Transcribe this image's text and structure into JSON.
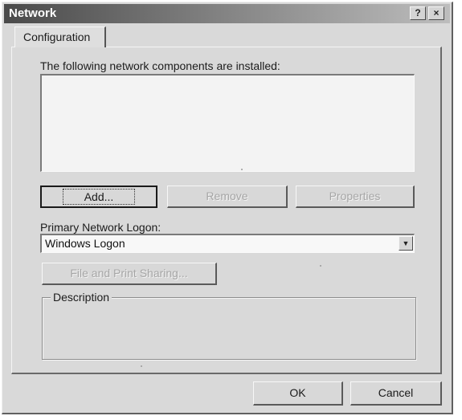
{
  "window": {
    "title": "Network",
    "help_glyph": "?",
    "close_glyph": "×"
  },
  "tabs": [
    {
      "label": "Configuration"
    }
  ],
  "installed_components": {
    "label": "The following network components are installed:",
    "items": []
  },
  "buttons": {
    "add": "Add...",
    "remove": "Remove",
    "properties": "Properties",
    "file_print_sharing": "File and Print Sharing...",
    "ok": "OK",
    "cancel": "Cancel"
  },
  "primary_logon": {
    "label": "Primary Network Logon:",
    "value": "Windows Logon",
    "arrow_glyph": "▼"
  },
  "description": {
    "legend": "Description"
  }
}
